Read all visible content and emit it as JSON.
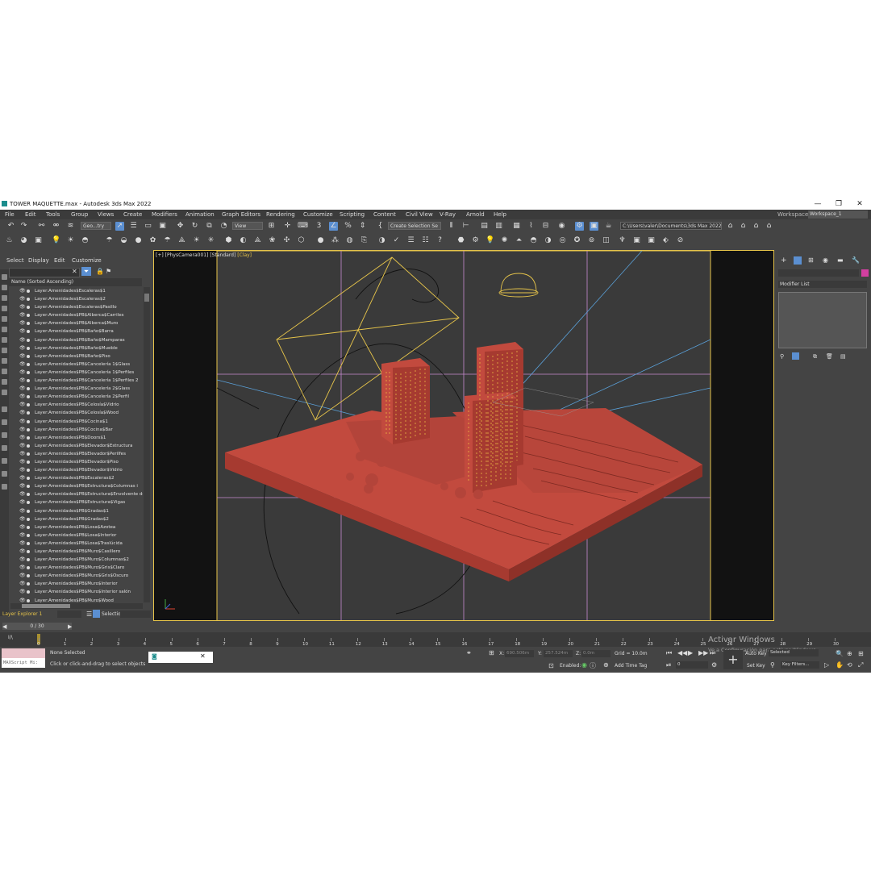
{
  "window": {
    "title": "TOWER MAQUETTE.max - Autodesk 3ds Max 2022",
    "controls": [
      "—",
      "❐",
      "✕"
    ]
  },
  "menu": [
    "File",
    "Edit",
    "Tools",
    "Group",
    "Views",
    "Create",
    "Modifiers",
    "Animation",
    "Graph Editors",
    "Rendering",
    "Customize",
    "Scripting",
    "Content",
    "Civil View",
    "V-Ray",
    "Arnold",
    "Help"
  ],
  "workspace": {
    "label": "Workspaces:",
    "value": "Workspace_1"
  },
  "toolbar": {
    "geometry_filter": "Geo...try",
    "ref_coord": "View",
    "selection_set": "Create Selection Se",
    "project_path": "C:\\Users\\valer\\Documents\\3ds Max 2022"
  },
  "explorer": {
    "menu": [
      "Select",
      "Display",
      "Edit",
      "Customize"
    ],
    "column_header": "Name (Sorted Ascending)",
    "layers": [
      "Layer:Amenidades$Escaleras$1",
      "Layer:Amenidades$Escaleras$2",
      "Layer:Amenidades$Escaleras$Pasillo",
      "Layer:Amenidades$PB$Alberca$Carriles",
      "Layer:Amenidades$PB$Alberca$Muro",
      "Layer:Amenidades$PB$Baño$Barra",
      "Layer:Amenidades$PB$Baño$Mamparas",
      "Layer:Amenidades$PB$Baño$Mueble",
      "Layer:Amenidades$PB$Baño$Piso",
      "Layer:Amenidades$PB$Cancelería 1$Glass",
      "Layer:Amenidades$PB$Cancelería 1$Perfiles",
      "Layer:Amenidades$PB$Cancelería 1$Perfiles 2",
      "Layer:Amenidades$PB$Cancelería 2$Glass",
      "Layer:Amenidades$PB$Cancelería 2$Perfil",
      "Layer:Amenidades$PB$Celosía$Vidrio",
      "Layer:Amenidades$PB$Celosía$Wood",
      "Layer:Amenidades$PB$Cocina$1",
      "Layer:Amenidades$PB$Cocina$Bar",
      "Layer:Amenidades$PB$Doors$1",
      "Layer:Amenidades$PB$Elevador$Estructura",
      "Layer:Amenidades$PB$Elevador$Perilfes",
      "Layer:Amenidades$PB$Elevador$Piso",
      "Layer:Amenidades$PB$Elevador$Vidrio",
      "Layer:Amenidades$PB$Escaleras$2",
      "Layer:Amenidades$PB$Estructura$Columnas i",
      "Layer:Amenidades$PB$Estructura$Envolvente de",
      "Layer:Amenidades$PB$Estructura$Vigas",
      "Layer:Amenidades$PB$Gradas$1",
      "Layer:Amenidades$PB$Gradas$2",
      "Layer:Amenidades$PB$Losa$Azotea",
      "Layer:Amenidades$PB$Losa$Interior",
      "Layer:Amenidades$PB$Losa$Traslúcida",
      "Layer:Amenidades$PB$Muro$Casillero",
      "Layer:Amenidades$PB$Muro$Columnas$2",
      "Layer:Amenidades$PB$Muro$Gris$Claro",
      "Layer:Amenidades$PB$Muro$Gris$Oscuro",
      "Layer:Amenidades$PB$Muro$Interior",
      "Layer:Amenidades$PB$Muro$Interior salón",
      "Layer:Amenidades$PB$Muro$Wood"
    ],
    "footer_label": "Layer Explorer 1",
    "selection_set_label": "Selection Set:",
    "frame_counter": "0 / 30"
  },
  "viewport": {
    "label_prefix": "[+]",
    "camera": "[PhysCamera001]",
    "mode": "[Standard]",
    "shading": "[Clay]"
  },
  "command_panel": {
    "modifier_list": "Modifier List"
  },
  "timeline": {
    "ticks": [
      "0",
      "1",
      "2",
      "3",
      "4",
      "5",
      "6",
      "7",
      "8",
      "9",
      "10",
      "11",
      "12",
      "13",
      "14",
      "15",
      "16",
      "17",
      "18",
      "19",
      "20",
      "21",
      "22",
      "23",
      "24",
      "25",
      "26",
      "27",
      "28",
      "29",
      "30"
    ],
    "key_icon": "I/\\"
  },
  "status": {
    "maxscript_placeholder": "MAXScript Mi:",
    "selection": "None Selected",
    "prompt": "Click or click-and-drag to select objects",
    "x_label": "X:",
    "x_value": "690.506m",
    "y_label": "Y:",
    "y_value": "257.524m",
    "z_label": "Z:",
    "z_value": "0.0m",
    "grid": "Grid = 10.0m",
    "enabled_label": "Enabled:",
    "add_time_tag": "Add Time Tag",
    "auto_key": "Auto Key",
    "set_key": "Set Key",
    "selected_dropdown": "Selected",
    "key_filters": "Key Filters...",
    "frame_value": "0",
    "activate_title": "Activar Windows",
    "activate_sub": "Ve a Configuración para activar Windows."
  },
  "colors": {
    "accent_yellow": "#e6c44a",
    "model_red": "#c24a3e",
    "active_blue": "#5b8fd1",
    "color_swatch": "#d23fa0"
  }
}
